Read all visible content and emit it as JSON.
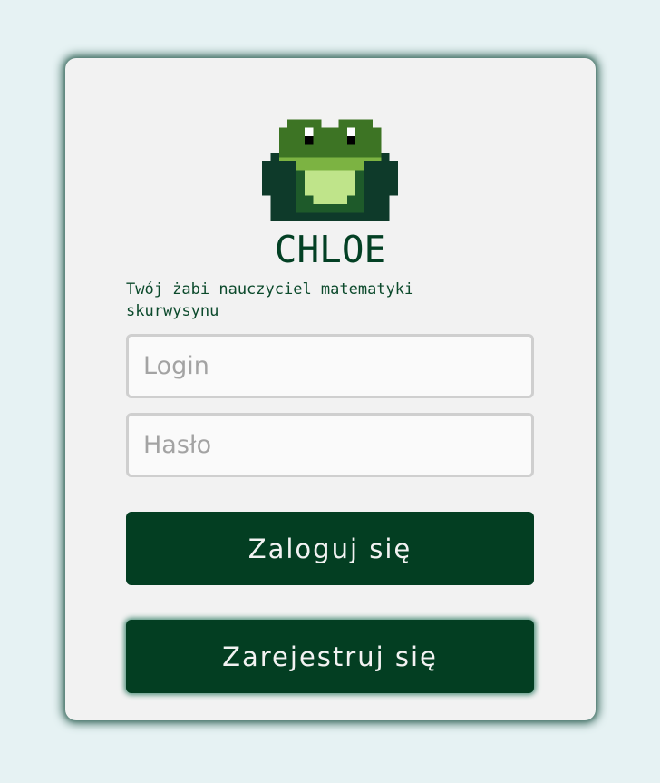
{
  "app": {
    "title": "CHLOE",
    "tagline": "Twój żabi nauczyciel matematyki skurwysynu"
  },
  "form": {
    "login_placeholder": "Login",
    "password_placeholder": "Hasło",
    "login_button": "Zaloguj się",
    "register_button": "Zarejestruj się"
  },
  "colors": {
    "page_background": "#e6f2f3",
    "card_background": "#f2f2f2",
    "brand_dark_green": "#033e22",
    "frog_green": "#3d7424",
    "frog_light_green": "#bfe48a"
  },
  "icons": {
    "logo": "pixel-frog-icon"
  }
}
